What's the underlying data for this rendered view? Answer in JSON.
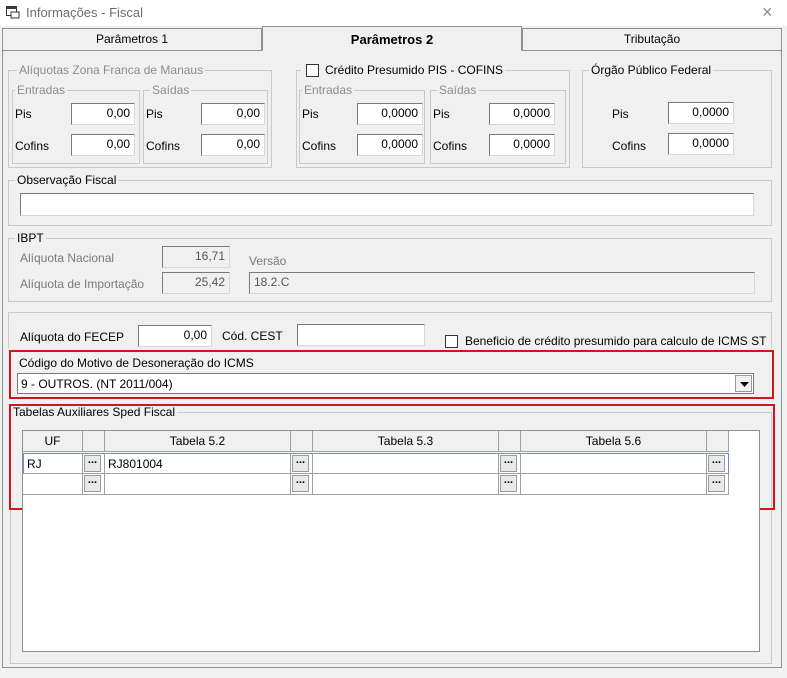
{
  "window": {
    "title": "Informações - Fiscal",
    "close": "×"
  },
  "tabs": [
    {
      "label": "Parâmetros 1"
    },
    {
      "label": "Parâmetros 2"
    },
    {
      "label": "Tributação"
    }
  ],
  "zona_franca": {
    "legend": "Alíquotas Zona Franca de Manaus",
    "entradas": {
      "legend": "Entradas",
      "pis_label": "Pis",
      "pis": "0,00",
      "cofins_label": "Cofins",
      "cofins": "0,00"
    },
    "saidas": {
      "legend": "Saídas",
      "pis_label": "Pis",
      "pis": "0,00",
      "cofins_label": "Cofins",
      "cofins": "0,00"
    }
  },
  "credito_presumido": {
    "legend": "Crédito Presumido PIS - COFINS",
    "entradas": {
      "legend": "Entradas",
      "pis_label": "Pis",
      "pis": "0,0000",
      "cofins_label": "Cofins",
      "cofins": "0,0000"
    },
    "saidas": {
      "legend": "Saídas",
      "pis_label": "Pis",
      "pis": "0,0000",
      "cofins_label": "Cofins",
      "cofins": "0,0000"
    }
  },
  "orgao_publico": {
    "legend": "Órgão Público Federal",
    "pis_label": "Pis",
    "pis": "0,0000",
    "cofins_label": "Cofins",
    "cofins": "0,0000"
  },
  "observacao": {
    "legend": "Observação Fiscal",
    "value": ""
  },
  "ibpt": {
    "legend": "IBPT",
    "nacional_label": "Alíquota Nacional",
    "nacional": "16,71",
    "importacao_label": "Alíquota de Importação",
    "importacao": "25,42",
    "versao_label": "Versão",
    "versao": "18.2.C"
  },
  "fecep": {
    "label": "Alíquota do FECEP",
    "value": "0,00",
    "cest_label": "Cód. CEST",
    "cest": "",
    "beneficio_label": "Beneficio de crédito presumido para calculo de ICMS ST"
  },
  "desoneracao": {
    "label": "Código do Motivo de Desoneração do ICMS",
    "value": "9 - OUTROS. (NT 2011/004)"
  },
  "sped": {
    "legend": "Tabelas Auxiliares Sped Fiscal",
    "columns": [
      "UF",
      "Tabela 5.2",
      "Tabela 5.3",
      "Tabela 5.6"
    ],
    "button_label": "...",
    "rows": [
      {
        "uf": "RJ",
        "t52": "RJ801004",
        "t53": "",
        "t56": ""
      },
      {
        "uf": "",
        "t52": "",
        "t53": "",
        "t56": ""
      }
    ]
  }
}
